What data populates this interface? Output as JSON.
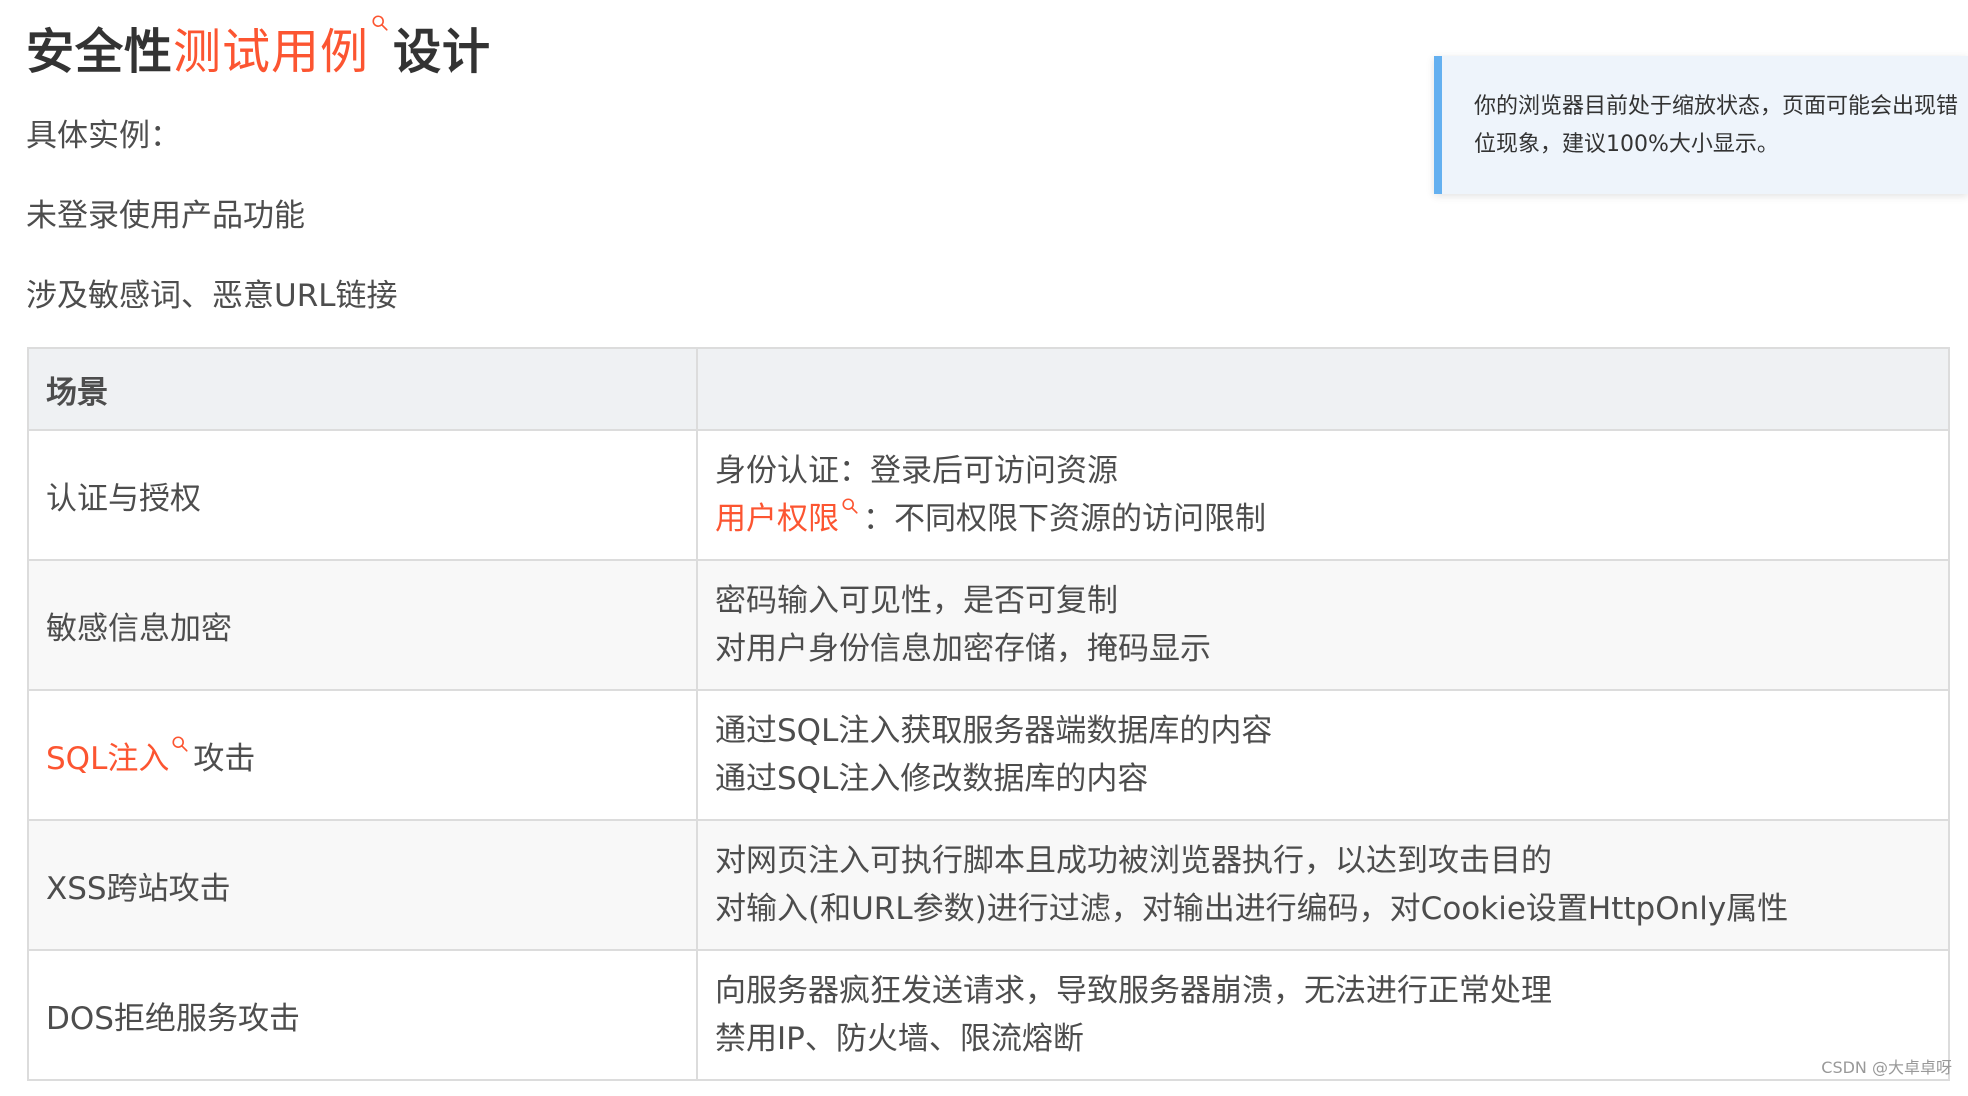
{
  "heading": {
    "prefix": "安全性",
    "link": "测试用例",
    "suffix": "设计"
  },
  "paragraphs": [
    "具体实例：",
    "未登录使用产品功能",
    "涉及敏感词、恶意URL链接"
  ],
  "notice": {
    "line1": "你的浏览器目前处于缩放状态，页面可能会出现错",
    "line2": "位现象，建议100%大小显示。"
  },
  "table": {
    "header": [
      "场景",
      ""
    ],
    "rows": [
      {
        "scene": "认证与授权",
        "line1": "身份认证：登录后可访问资源",
        "line2_link": "用户权限",
        "line2_rest": "：不同权限下资源的访问限制"
      },
      {
        "scene": "敏感信息加密",
        "line1": "密码输入可见性，是否可复制",
        "line2": "对用户身份信息加密存储，掩码显示"
      },
      {
        "scene_link": "SQL注入",
        "scene_rest": "攻击",
        "line1": "通过SQL注入获取服务器端数据库的内容",
        "line2": "通过SQL注入修改数据库的内容"
      },
      {
        "scene": "XSS跨站攻击",
        "line1": "对网页注入可执行脚本且成功被浏览器执行，以达到攻击目的",
        "line2": "对输入(和URL参数)进行过滤，对输出进行编码，对Cookie设置HttpOnly属性"
      },
      {
        "scene": "DOS拒绝服务攻击",
        "line1": "向服务器疯狂发送请求，导致服务器崩溃，无法进行正常处理",
        "line2": "禁用IP、防火墙、限流熔断"
      }
    ]
  },
  "watermark": "CSDN @大卓卓呀",
  "colors": {
    "link": "#fc5531",
    "notice_border": "#64b0f0",
    "table_header_bg": "#eff1f3"
  },
  "icons": {
    "keyword_search": "search-icon"
  }
}
